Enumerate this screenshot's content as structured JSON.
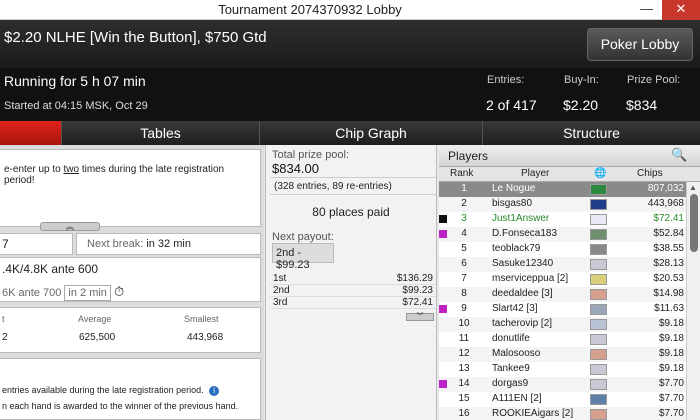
{
  "window": {
    "title": "Tournament 2074370932 Lobby",
    "minimize": "—",
    "close": "✕"
  },
  "header": {
    "tournament_name": "$2.20 NLHE [Win the Button], $750 Gtd",
    "lobby_button": "Poker Lobby"
  },
  "info": {
    "running": "Running for 5 h 07 min",
    "started": "Started at 04:15 MSK, Oct 29",
    "entries_label": "Entries:",
    "entries_value": "2 of 417",
    "buyin_label": "Buy-In:",
    "buyin_value": "$2.20",
    "prize_label": "Prize Pool:",
    "prize_value": "$834"
  },
  "tabs": [
    {
      "label": ""
    },
    {
      "label": "Tables"
    },
    {
      "label": "Chip Graph"
    },
    {
      "label": "Structure"
    }
  ],
  "notice": {
    "text_before": "e-enter up to ",
    "text_underlined": "two",
    "text_after": " times during the late registration period!"
  },
  "left": {
    "level_num": "7",
    "next_break_label": "Next break:",
    "next_break_value": "in 32 min",
    "current_blinds": ".4K/4.8K ante 600",
    "next_blinds": "6K ante 700",
    "next_in": "in 2 min",
    "stack_col1": "t",
    "stack_avg_label": "Average",
    "stack_small_label": "Smallest",
    "stack_val1": "2",
    "stack_avg": "625,500",
    "stack_small": "443,968",
    "info_line1": "entries available during the late registration period.",
    "info_line2": "n each hand is awarded to the winner of the previous hand."
  },
  "middle": {
    "total_label": "Total prize pool:",
    "total_value": "$834.00",
    "entries_detail": "(328 entries, 89 re-entries)",
    "places_paid": "80 places paid",
    "next_payout_label": "Next payout:",
    "next_payout_value": "2nd - $99.23",
    "payouts": [
      {
        "place": "1st",
        "amount": "$136.29"
      },
      {
        "place": "2nd",
        "amount": "$99.23"
      },
      {
        "place": "3rd",
        "amount": "$72.41"
      }
    ]
  },
  "players": {
    "title": "Players",
    "col_rank": "Rank",
    "col_player": "Player",
    "col_chips": "Chips",
    "rows": [
      {
        "rank": "1",
        "name": "Le Nogue",
        "chips": "807,032",
        "flag": "#2b8a3e",
        "mark": ""
      },
      {
        "rank": "2",
        "name": "bisgas80",
        "chips": "443,968",
        "flag": "#1f3c88",
        "mark": ""
      },
      {
        "rank": "3",
        "name": "Just1Answer",
        "chips": "$72.41",
        "flag": "#e9e9f5",
        "mark": "#111111"
      },
      {
        "rank": "4",
        "name": "D.Fonseca183",
        "chips": "$52.84",
        "flag": "#6f8f6f",
        "mark": "#c020c8"
      },
      {
        "rank": "5",
        "name": "teoblack79",
        "chips": "$38.55",
        "flag": "#888888",
        "mark": ""
      },
      {
        "rank": "6",
        "name": "Sasuke12340",
        "chips": "$28.13",
        "flag": "#c9c9d6",
        "mark": ""
      },
      {
        "rank": "7",
        "name": "mserviceppua [2]",
        "chips": "$20.53",
        "flag": "#d9cf7a",
        "mark": ""
      },
      {
        "rank": "8",
        "name": "deedaldee [3]",
        "chips": "$14.98",
        "flag": "#d6a08f",
        "mark": ""
      },
      {
        "rank": "9",
        "name": "Slart42 [3]",
        "chips": "$11.63",
        "flag": "#9aa7b8",
        "mark": "#c020c8"
      },
      {
        "rank": "10",
        "name": "tacherovip [2]",
        "chips": "$9.18",
        "flag": "#b8c4d6",
        "mark": ""
      },
      {
        "rank": "11",
        "name": "donutlife",
        "chips": "$9.18",
        "flag": "#c9c9d6",
        "mark": ""
      },
      {
        "rank": "12",
        "name": "Malosooso",
        "chips": "$9.18",
        "flag": "#d6a08f",
        "mark": ""
      },
      {
        "rank": "13",
        "name": "Tankee9",
        "chips": "$9.18",
        "flag": "#c9c9d6",
        "mark": ""
      },
      {
        "rank": "14",
        "name": "dorgas9",
        "chips": "$7.70",
        "flag": "#c9c9d6",
        "mark": "#c020c8"
      },
      {
        "rank": "15",
        "name": "A111EN [2]",
        "chips": "$7.70",
        "flag": "#5e7fa8",
        "mark": ""
      },
      {
        "rank": "16",
        "name": "ROOKIEAigars [2]",
        "chips": "$7.70",
        "flag": "#d6a08f",
        "mark": ""
      }
    ]
  }
}
